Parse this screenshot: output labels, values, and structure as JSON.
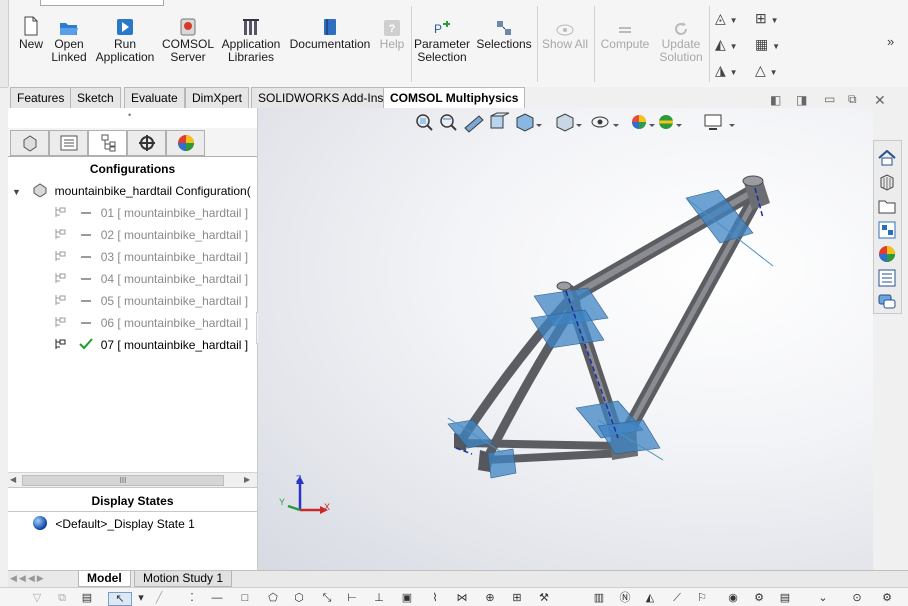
{
  "ribbon": {
    "buttons": [
      {
        "label": "New",
        "icon": "new-document-icon",
        "enabled": true
      },
      {
        "label": "Open\nLinked",
        "icon": "open-folder-icon",
        "enabled": true
      },
      {
        "label": "Run\nApplication",
        "icon": "run-application-icon",
        "enabled": true
      },
      {
        "label": "COMSOL\nServer",
        "icon": "comsol-server-icon",
        "enabled": true
      },
      {
        "label": "Application\nLibraries",
        "icon": "libraries-icon",
        "enabled": true
      },
      {
        "label": "Documentation",
        "icon": "documentation-icon",
        "enabled": true
      },
      {
        "label": "Help",
        "icon": "help-icon",
        "enabled": false
      },
      {
        "label": "Parameter\nSelection",
        "icon": "parameter-selection-icon",
        "enabled": true
      },
      {
        "label": "Selections",
        "icon": "selections-icon",
        "enabled": true
      },
      {
        "label": "Show All",
        "icon": "show-all-icon",
        "enabled": false
      },
      {
        "label": "Compute",
        "icon": "compute-icon",
        "enabled": false
      },
      {
        "label": "Update\nSolution",
        "icon": "update-solution-icon",
        "enabled": false
      }
    ],
    "more_glyph": "»"
  },
  "tabs": [
    "Features",
    "Sketch",
    "Evaluate",
    "DimXpert",
    "SOLIDWORKS Add-Ins",
    "COMSOL Multiphysics"
  ],
  "active_tab": "COMSOL Multiphysics",
  "config_panel": {
    "dot": "•",
    "heading": "Configurations",
    "root": "mountainbike_hardtail Configuration(",
    "items": [
      {
        "label": "01 [ mountainbike_hardtail ]",
        "active": false
      },
      {
        "label": "02 [ mountainbike_hardtail ]",
        "active": false
      },
      {
        "label": "03 [ mountainbike_hardtail ]",
        "active": false
      },
      {
        "label": "04 [ mountainbike_hardtail ]",
        "active": false
      },
      {
        "label": "05 [ mountainbike_hardtail ]",
        "active": false
      },
      {
        "label": "06 [ mountainbike_hardtail ]",
        "active": false
      },
      {
        "label": "07 [ mountainbike_hardtail ]",
        "active": true
      }
    ],
    "scroll_grip": "III",
    "display_states_heading": "Display States",
    "display_state": "<Default>_Display State 1"
  },
  "triad": {
    "x": "X",
    "y": "Y",
    "z": "Z"
  },
  "bottom_tabs": [
    "Model",
    "Motion Study 1"
  ],
  "active_bottom_tab": "Model",
  "colors": {
    "accent": "#1e5aa8",
    "frame": "#6e7075",
    "plane": "#4a8fc4"
  }
}
